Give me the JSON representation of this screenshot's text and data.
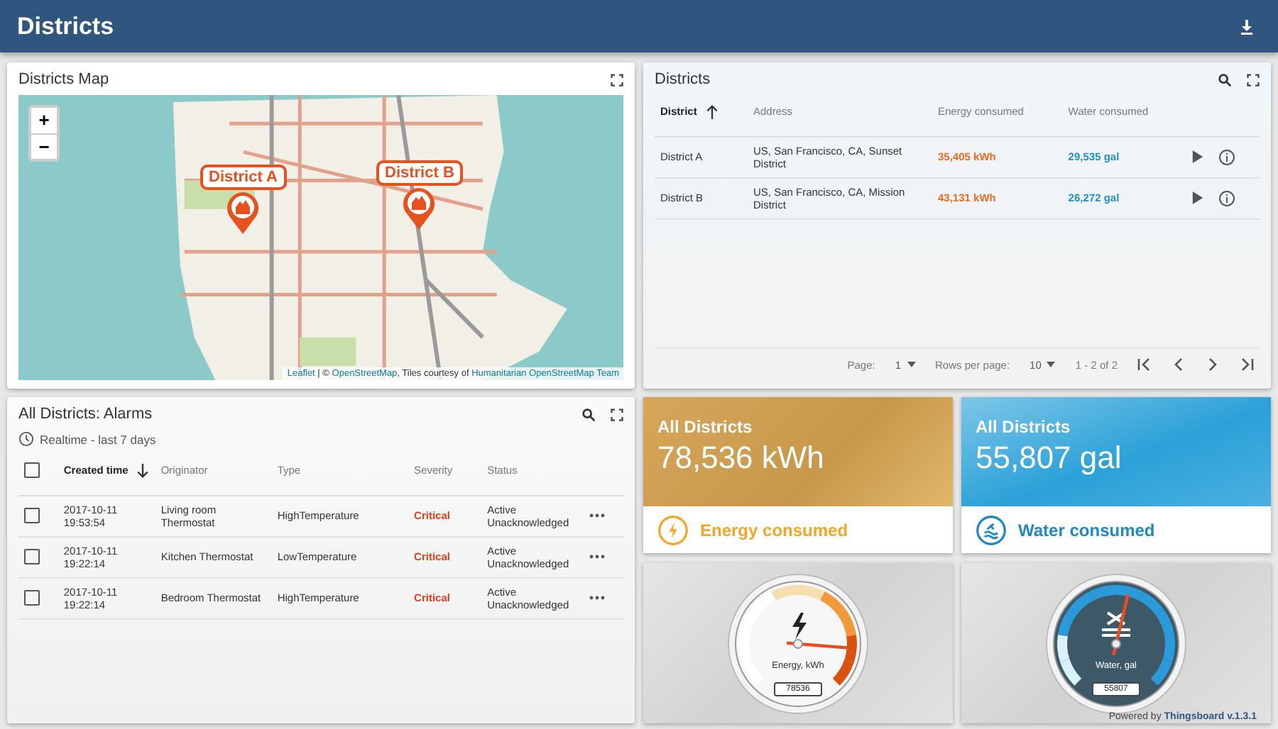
{
  "header": {
    "title": "Districts"
  },
  "map_panel": {
    "title": "Districts Map",
    "zoom_in": "+",
    "zoom_out": "−",
    "markers": [
      {
        "label": "District A"
      },
      {
        "label": "District B"
      }
    ],
    "attribution": {
      "leaflet": "Leaflet",
      "text_1": " | © ",
      "osm": "OpenStreetMap",
      "text_2": ", Tiles courtesy of ",
      "hot": "Humanitarian OpenStreetMap Team"
    }
  },
  "districts_panel": {
    "title": "Districts",
    "columns": [
      {
        "label": "District",
        "sorted": true
      },
      {
        "label": "Address",
        "sorted": false
      },
      {
        "label": "Energy consumed",
        "sorted": false
      },
      {
        "label": "Water consumed",
        "sorted": false
      }
    ],
    "rows": [
      {
        "district": "District A",
        "address": "US, San Francisco, CA, Sunset District",
        "energy": "35,405 kWh",
        "water": "29,535 gal"
      },
      {
        "district": "District B",
        "address": "US, San Francisco, CA, Mission District",
        "energy": "43,131 kWh",
        "water": "26,272 gal"
      }
    ],
    "pager": {
      "page_label": "Page:",
      "page": "1",
      "rows_label": "Rows per page:",
      "rows": "10",
      "range": "1 - 2 of 2"
    }
  },
  "alarms_panel": {
    "title": "All Districts: Alarms",
    "timewindow": "Realtime - last 7 days",
    "select_all": {
      "checked": false
    },
    "columns": [
      {
        "label": "Created time",
        "sorted": true
      },
      {
        "label": "Originator",
        "sorted": false
      },
      {
        "label": "Type",
        "sorted": false
      },
      {
        "label": "Severity",
        "sorted": false
      },
      {
        "label": "Status",
        "sorted": false
      }
    ],
    "rows": [
      {
        "checked": false,
        "time": "2017-10-11 19:53:54",
        "originator": "Living room Thermostat",
        "type": "HighTemperature",
        "severity": "Critical",
        "status": "Active Unacknowledged"
      },
      {
        "checked": false,
        "time": "2017-10-11 19:22:14",
        "originator": "Kitchen Thermostat",
        "type": "LowTemperature",
        "severity": "Critical",
        "status": "Active Unacknowledged"
      },
      {
        "checked": false,
        "time": "2017-10-11 19:22:14",
        "originator": "Bedroom Thermostat",
        "type": "HighTemperature",
        "severity": "Critical",
        "status": "Active Unacknowledged"
      }
    ]
  },
  "cards": [
    {
      "kind": "energy",
      "title": "All Districts",
      "value": "78,536 kWh",
      "label": "Energy consumed",
      "color": "#f5a623"
    },
    {
      "kind": "water",
      "title": "All Districts",
      "value": "55,807 gal",
      "label": "Water consumed",
      "color": "#1e88c8"
    }
  ],
  "gauges": [
    {
      "kind": "energy",
      "label": "Energy, kWh",
      "reading": "78536",
      "level": 0.85
    },
    {
      "kind": "water",
      "label": "Water, gal",
      "reading": "55807",
      "level": 0.55
    }
  ],
  "footer": {
    "text": "Powered by ",
    "link": "Thingsboard v.1.3.1"
  }
}
